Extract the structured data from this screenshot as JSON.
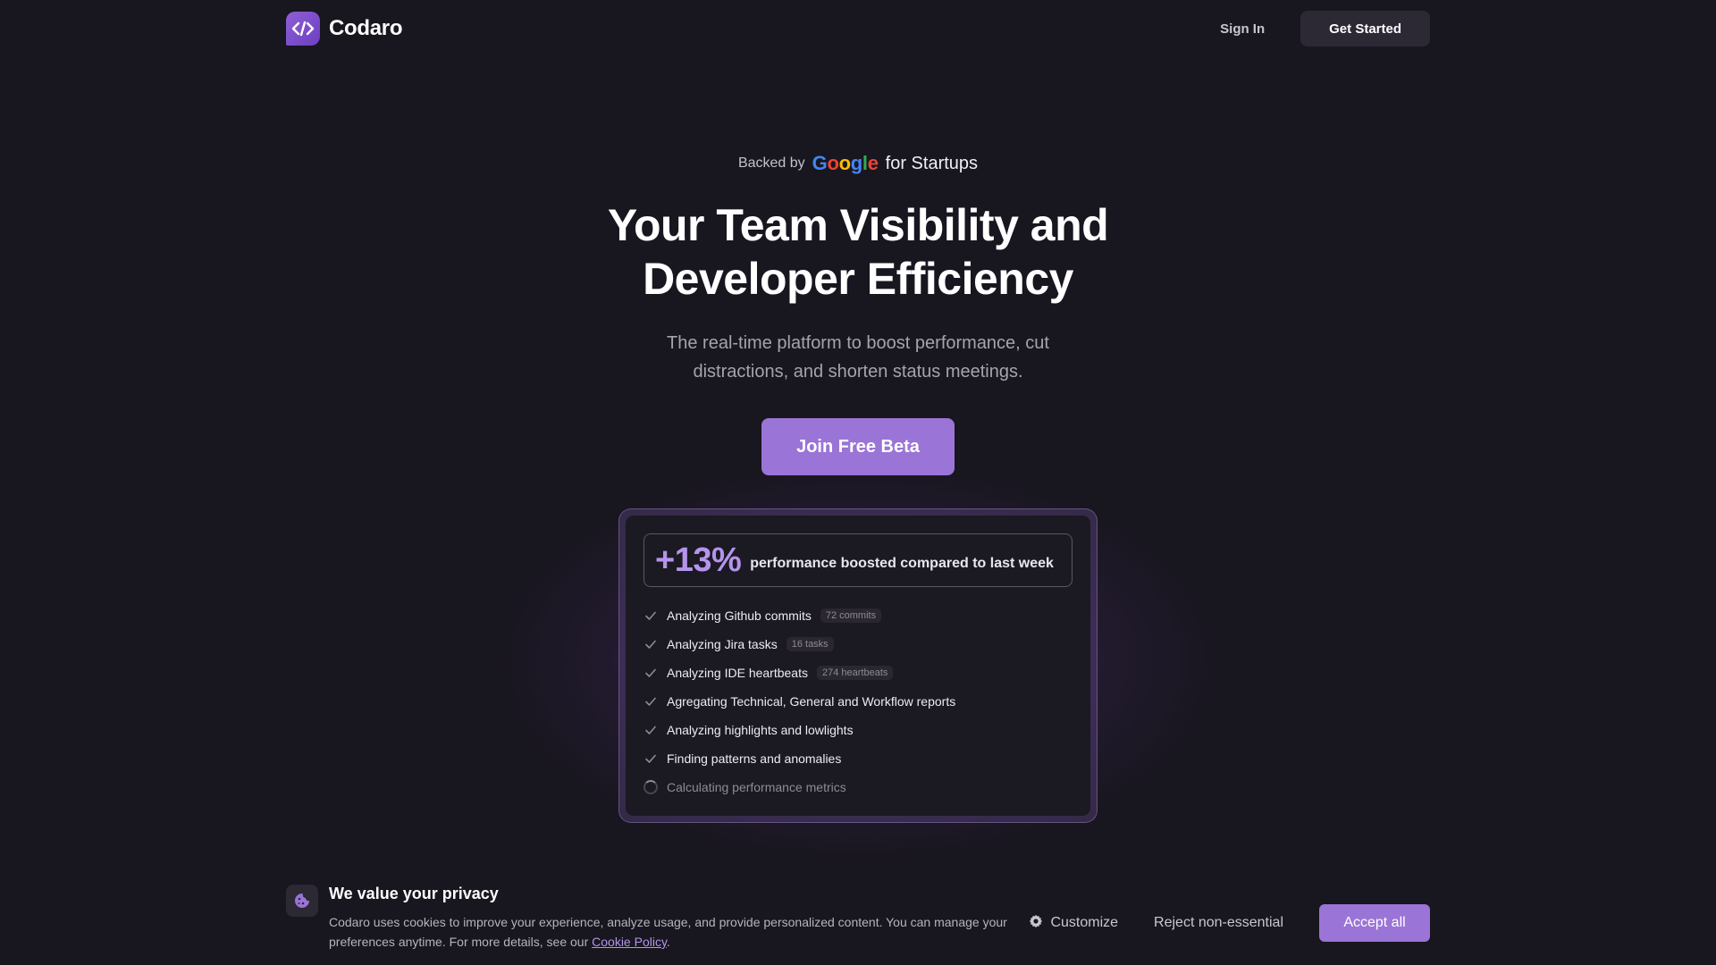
{
  "header": {
    "brand_name": "Codaro",
    "sign_in_label": "Sign In",
    "get_started_label": "Get Started"
  },
  "hero": {
    "backed_by": "Backed by",
    "google_letters": [
      "G",
      "o",
      "o",
      "g",
      "l",
      "e"
    ],
    "for_startups": "for Startups",
    "title_line1": "Your Team Visibility and",
    "title_line2": "Developer Efficiency",
    "subtitle": "The real-time platform to boost performance, cut distractions, and shorten status meetings.",
    "cta_label": "Join Free Beta"
  },
  "card": {
    "stat_value": "+13%",
    "stat_label": "performance boosted compared to last week",
    "tasks": [
      {
        "label": "Analyzing Github commits",
        "badge": "72 commits",
        "status": "done"
      },
      {
        "label": "Analyzing Jira tasks",
        "badge": "16 tasks",
        "status": "done"
      },
      {
        "label": "Analyzing IDE heartbeats",
        "badge": "274 heartbeats",
        "status": "done"
      },
      {
        "label": "Agregating Technical, General and Workflow reports",
        "badge": "",
        "status": "done"
      },
      {
        "label": "Analyzing highlights and lowlights",
        "badge": "",
        "status": "done"
      },
      {
        "label": "Finding patterns and anomalies",
        "badge": "",
        "status": "done"
      },
      {
        "label": "Calculating performance metrics",
        "badge": "",
        "status": "pending"
      }
    ]
  },
  "cookie": {
    "title": "We value your privacy",
    "body": "Codaro uses cookies to improve your experience, analyze usage, and provide personalized content. You can manage your preferences anytime. For more details, see our",
    "link_label": "Cookie Policy",
    "body_end": ".",
    "customize_label": "Customize",
    "reject_label": "Reject non-essential",
    "accept_label": "Accept all"
  },
  "colors": {
    "background": "#18161f",
    "accent": "#9a74d6",
    "stat_accent": "#b594ec"
  }
}
